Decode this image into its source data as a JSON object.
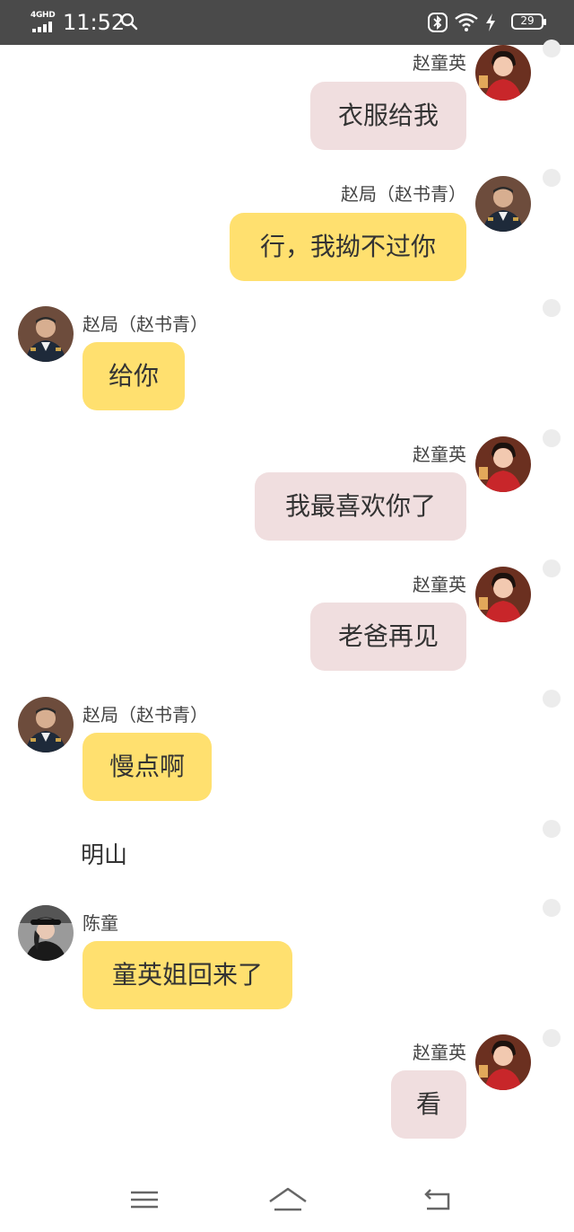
{
  "status_bar": {
    "network": "4GHD",
    "time": "11:52",
    "battery": "29"
  },
  "messages": [
    {
      "side": "right",
      "sender": "赵童英",
      "text": "衣服给我",
      "bubble": "pink",
      "avatar": "woman-red-dress"
    },
    {
      "side": "right",
      "sender": "赵局（赵书青）",
      "text": "行，我拗不过你",
      "bubble": "yellow",
      "avatar": "man-police-uniform"
    },
    {
      "side": "left",
      "sender": "赵局（赵书青）",
      "text": "给你",
      "bubble": "yellow",
      "avatar": "man-police-uniform"
    },
    {
      "side": "right",
      "sender": "赵童英",
      "text": "我最喜欢你了",
      "bubble": "pink",
      "avatar": "woman-red-dress"
    },
    {
      "side": "right",
      "sender": "赵童英",
      "text": "老爸再见",
      "bubble": "pink",
      "avatar": "woman-red-dress"
    },
    {
      "side": "left",
      "sender": "赵局（赵书青）",
      "text": "慢点啊",
      "bubble": "yellow",
      "avatar": "man-police-uniform"
    },
    {
      "side": "narration",
      "text": "明山"
    },
    {
      "side": "left",
      "sender": "陈童",
      "text": "童英姐回来了",
      "bubble": "yellow",
      "avatar": "person-black-hat"
    },
    {
      "side": "right",
      "sender": "赵童英",
      "text": "看",
      "bubble": "pink",
      "avatar": "woman-red-dress"
    }
  ],
  "nav_bar": {
    "menu_icon": "menu-icon",
    "home_icon": "home-icon",
    "back_icon": "back-icon"
  },
  "colors": {
    "status_bar": "#4a4a4a",
    "bubble_pink": "#f0dedf",
    "bubble_yellow": "#ffe06f",
    "dot": "#ececec"
  }
}
